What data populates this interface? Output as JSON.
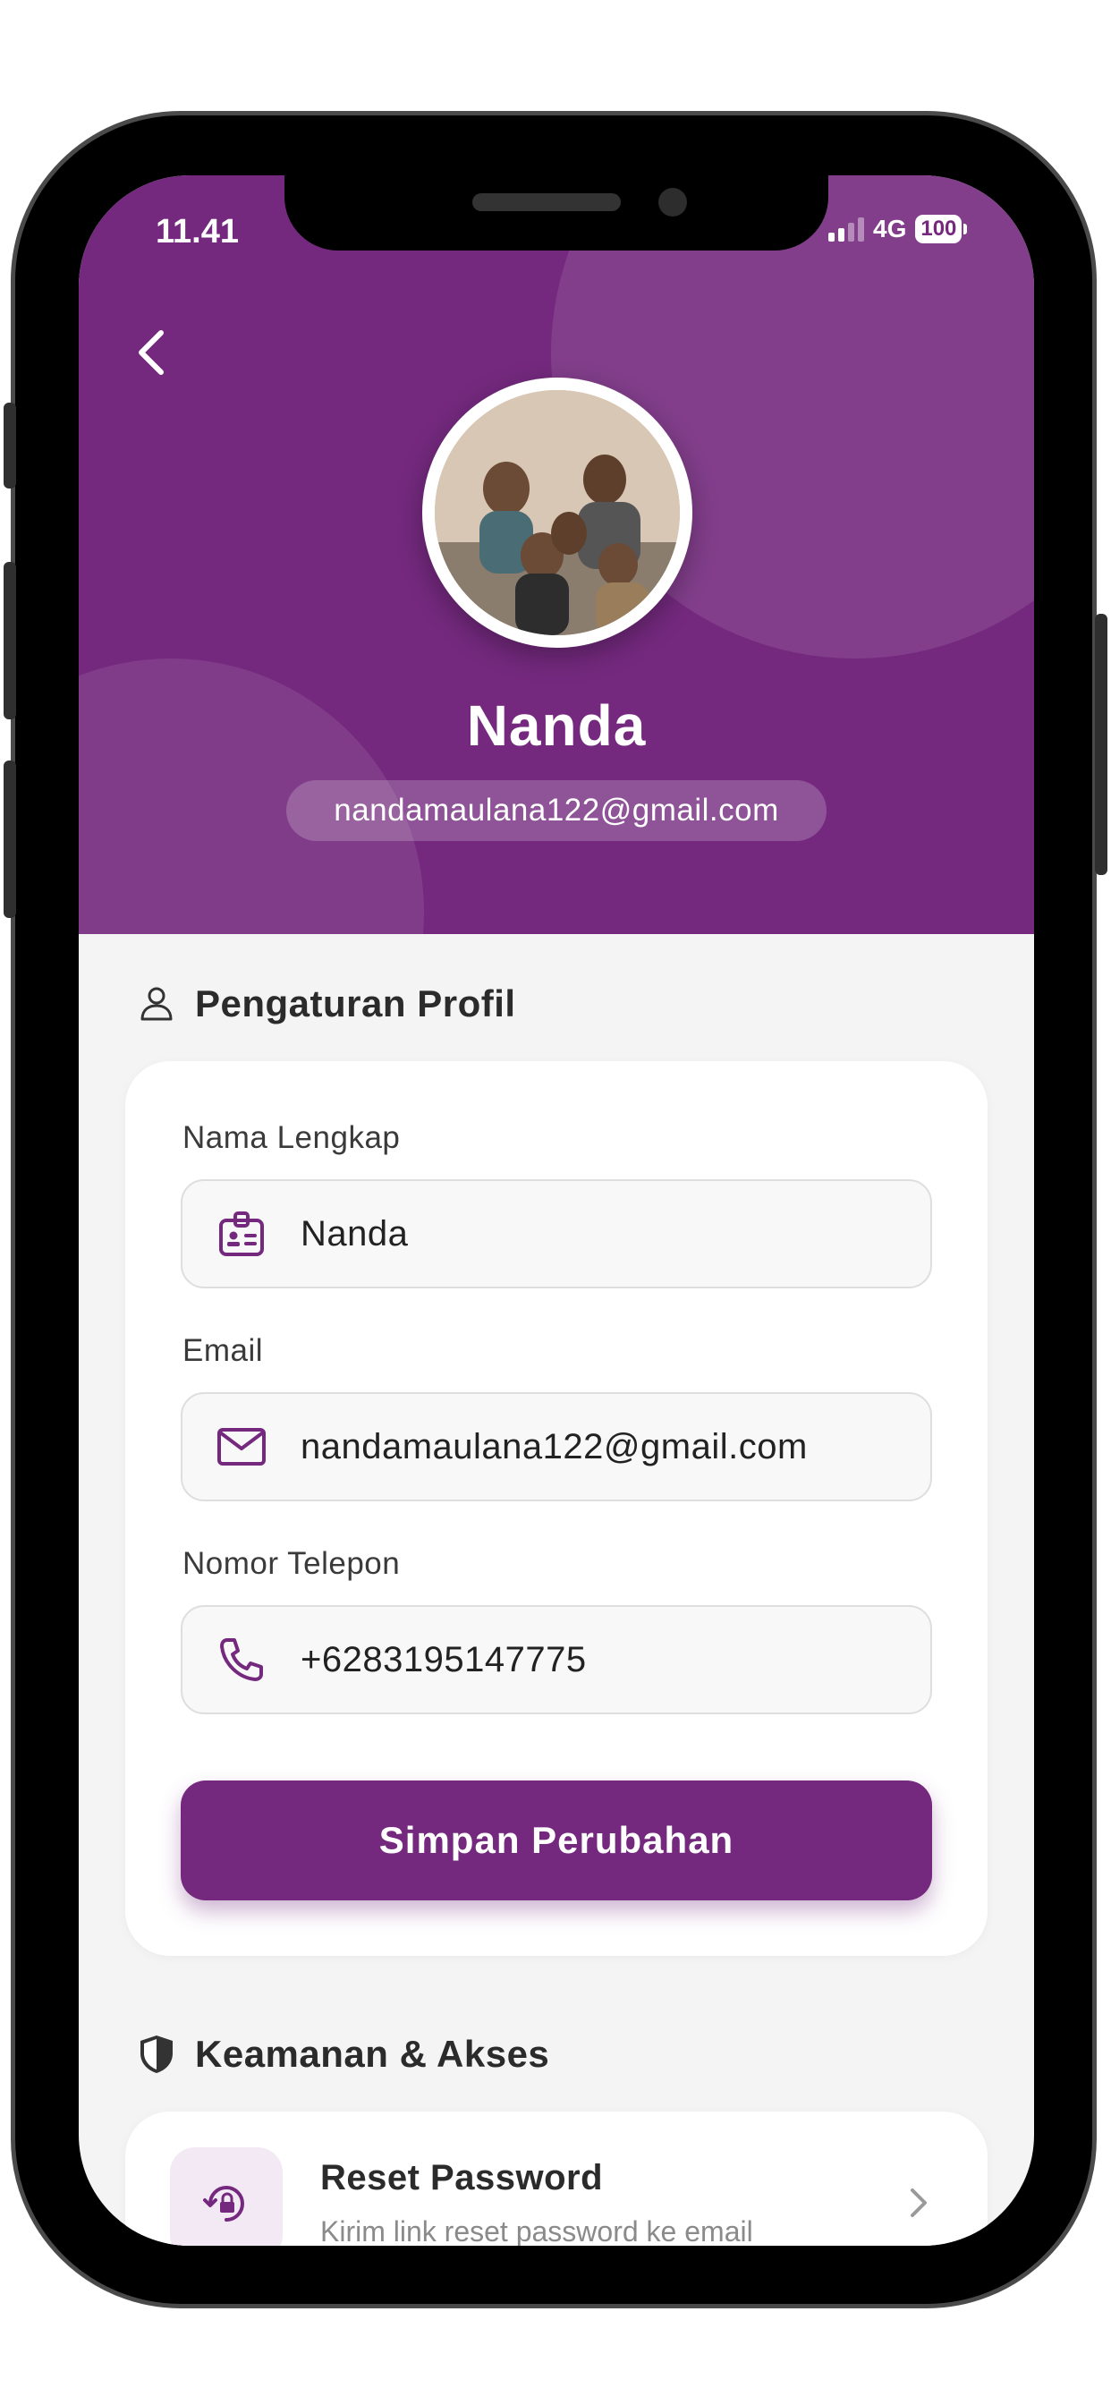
{
  "status_bar": {
    "time": "11.41",
    "network": "4G",
    "battery": "100"
  },
  "profile": {
    "name": "Nanda",
    "email": "nandamaulana122@gmail.com"
  },
  "settings_section": {
    "title": "Pengaturan Profil",
    "fields": [
      {
        "label": "Nama Lengkap",
        "value": "Nanda",
        "icon": "id-badge-icon"
      },
      {
        "label": "Email",
        "value": "nandamaulana122@gmail.com",
        "icon": "mail-icon"
      },
      {
        "label": "Nomor Telepon",
        "value": "+6283195147775",
        "icon": "phone-icon"
      }
    ],
    "save_label": "Simpan Perubahan"
  },
  "security_section": {
    "title": "Keamanan & Akses",
    "items": [
      {
        "title": "Reset Password",
        "subtitle": "Kirim link reset password ke email",
        "icon": "lock-reset-icon"
      }
    ]
  },
  "colors": {
    "primary": "#74297e",
    "background": "#f4f4f4",
    "card": "#ffffff"
  }
}
